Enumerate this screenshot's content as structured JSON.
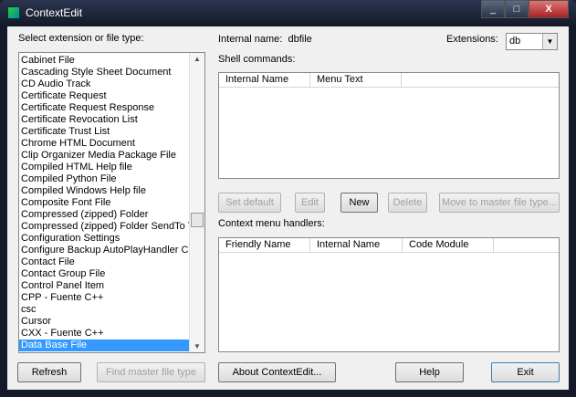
{
  "window": {
    "title": "ContextEdit",
    "minimize": "_",
    "maximize": "□",
    "close": "X"
  },
  "left": {
    "label": "Select extension or file type:",
    "items": [
      "Cabinet File",
      "Cascading Style Sheet Document",
      "CD Audio Track",
      "Certificate Request",
      "Certificate Request Response",
      "Certificate Revocation List",
      "Certificate Trust List",
      "Chrome HTML Document",
      "Clip Organizer Media Package File",
      "Compiled HTML Help file",
      "Compiled Python File",
      "Compiled Windows Help file",
      "Composite Font File",
      "Compressed (zipped) Folder",
      "Compressed (zipped) Folder SendTo Target",
      "Configuration Settings",
      "Configure Backup AutoPlayHandler Class",
      "Contact File",
      "Contact Group File",
      "Control Panel Item",
      "CPP - Fuente C++",
      "csc",
      "Cursor",
      "CXX - Fuente C++",
      "Data Base File"
    ],
    "selected": "Data Base File"
  },
  "right": {
    "internal_name_label": "Internal name:",
    "internal_name": "dbfile",
    "extensions_label": "Extensions:",
    "extension": "db",
    "shell_label": "Shell commands:",
    "shell_cols": [
      "Internal Name",
      "Menu Text"
    ],
    "buttons": {
      "set_default": "Set default",
      "edit": "Edit",
      "new": "New",
      "delete": "Delete",
      "move": "Move to master file type..."
    },
    "handlers_label": "Context menu handlers:",
    "handler_cols": [
      "Friendly Name",
      "Internal Name",
      "Code Module"
    ]
  },
  "bottom": {
    "refresh": "Refresh",
    "find": "Find master file type",
    "about": "About ContextEdit...",
    "help": "Help",
    "exit": "Exit"
  }
}
